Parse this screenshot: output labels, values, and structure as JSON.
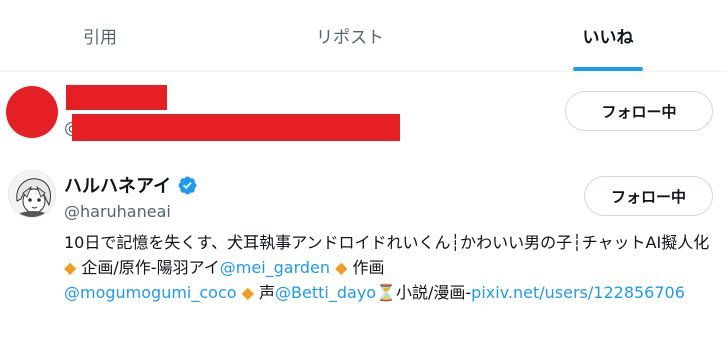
{
  "tabs": [
    {
      "label": "引用",
      "active": false
    },
    {
      "label": "リポスト",
      "active": false
    },
    {
      "label": "いいね",
      "active": true
    }
  ],
  "colors": {
    "accent": "#1d9bf0",
    "redaction": "#e51f23",
    "diamond": "#f29c1f"
  },
  "users": [
    {
      "handle_prefix": "@",
      "follow_label": "フォロー中",
      "redacted": true
    },
    {
      "name": "ハルハネアイ",
      "verified_icon": "verified-badge-icon",
      "handle": "@haruhaneai",
      "follow_label": "フォロー中",
      "bio": {
        "t1": "10日で記憶を失くす、犬耳執事アンドロイドれいくん┆かわいい男の子┆チャットAI擬人化 ",
        "d1": "◆",
        "t2": " 企画/原作-陽羽アイ",
        "l1": "@mei_garden",
        "t3": " ",
        "d2": "◆",
        "t4": " 作画",
        "l2": "@mogumogumi_coco",
        "t5": " ",
        "d3": "◆",
        "t6": " 声",
        "l3": "@Betti_dayo",
        "hourglass": "⏳",
        "t7": "小説/漫画-",
        "l4": "pixiv.net/users/122856706"
      }
    }
  ]
}
